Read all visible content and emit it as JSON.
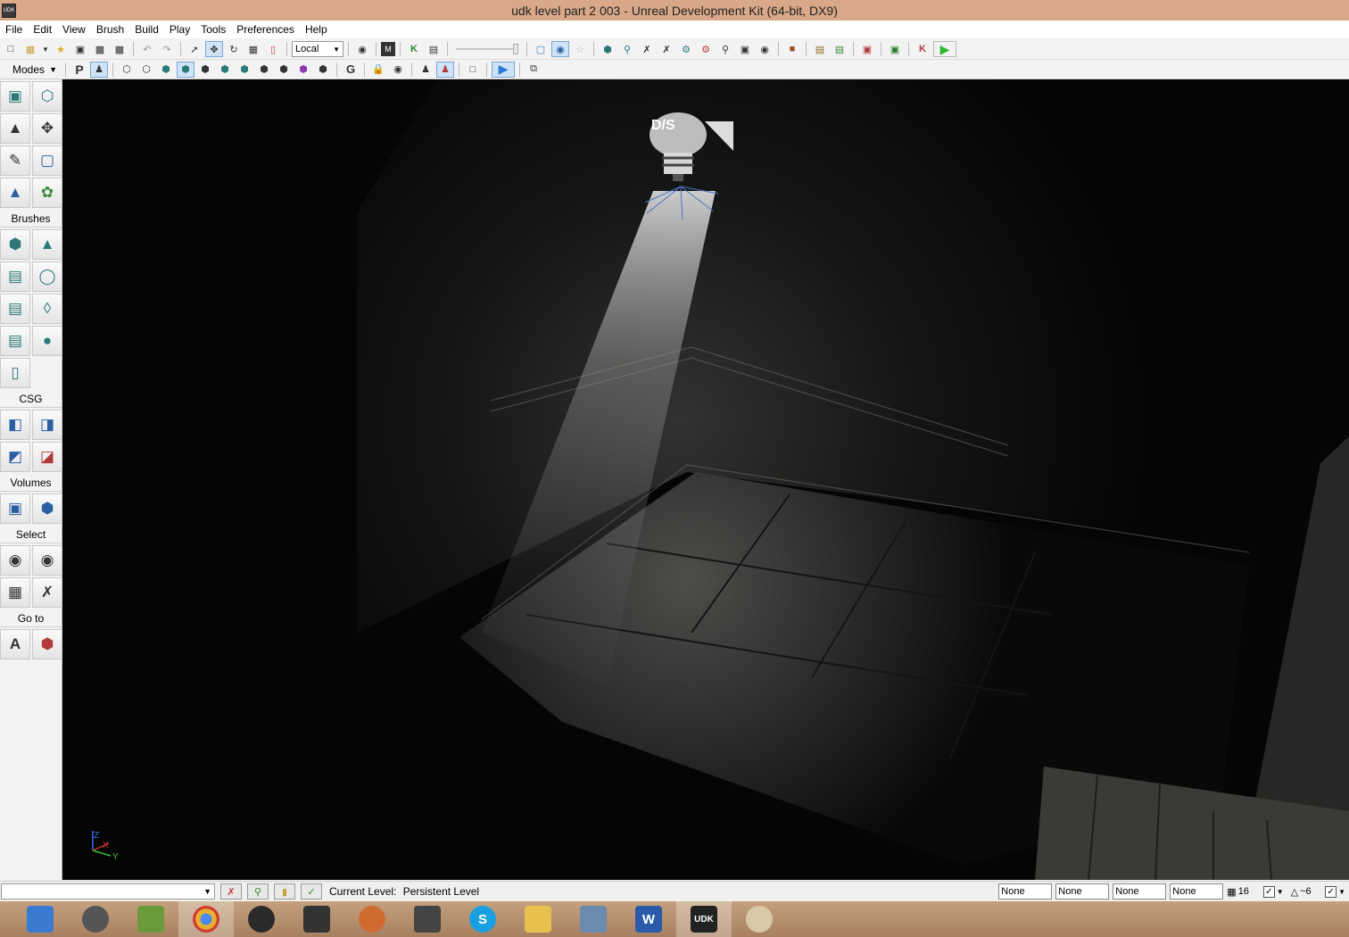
{
  "window": {
    "title": "udk level part 2 003 - Unreal Development Kit (64-bit, DX9)",
    "app_icon_label": "UDK"
  },
  "menu": [
    "File",
    "Edit",
    "View",
    "Brush",
    "Build",
    "Play",
    "Tools",
    "Preferences",
    "Help"
  ],
  "toolbar": {
    "coord_system": "Local",
    "letter_p": "P",
    "letter_g": "G"
  },
  "modes_label": "Modes",
  "panel": {
    "brushes": "Brushes",
    "csg": "CSG",
    "volumes": "Volumes",
    "select": "Select",
    "goto": "Go to"
  },
  "viewport": {
    "light_label": "D/S",
    "axis_z": "Z",
    "axis_x": "X",
    "axis_y": "Y"
  },
  "status": {
    "current_level_label": "Current Level:",
    "current_level_value": "Persistent Level",
    "none_fields": [
      "None",
      "None",
      "None",
      "None"
    ],
    "grid_size": "16",
    "rot_snap": "~6"
  },
  "taskbar": {
    "apps": [
      {
        "name": "explorer-desktop",
        "label": ""
      },
      {
        "name": "audio",
        "label": ""
      },
      {
        "name": "minecraft",
        "label": ""
      },
      {
        "name": "chrome",
        "label": ""
      },
      {
        "name": "steam",
        "label": ""
      },
      {
        "name": "inkscape",
        "label": ""
      },
      {
        "name": "game",
        "label": ""
      },
      {
        "name": "unity",
        "label": ""
      },
      {
        "name": "skype",
        "label": "S"
      },
      {
        "name": "file-explorer",
        "label": ""
      },
      {
        "name": "calculator",
        "label": ""
      },
      {
        "name": "word",
        "label": "W"
      },
      {
        "name": "udk",
        "label": "UDK"
      },
      {
        "name": "paint",
        "label": ""
      }
    ],
    "active": "udk"
  }
}
